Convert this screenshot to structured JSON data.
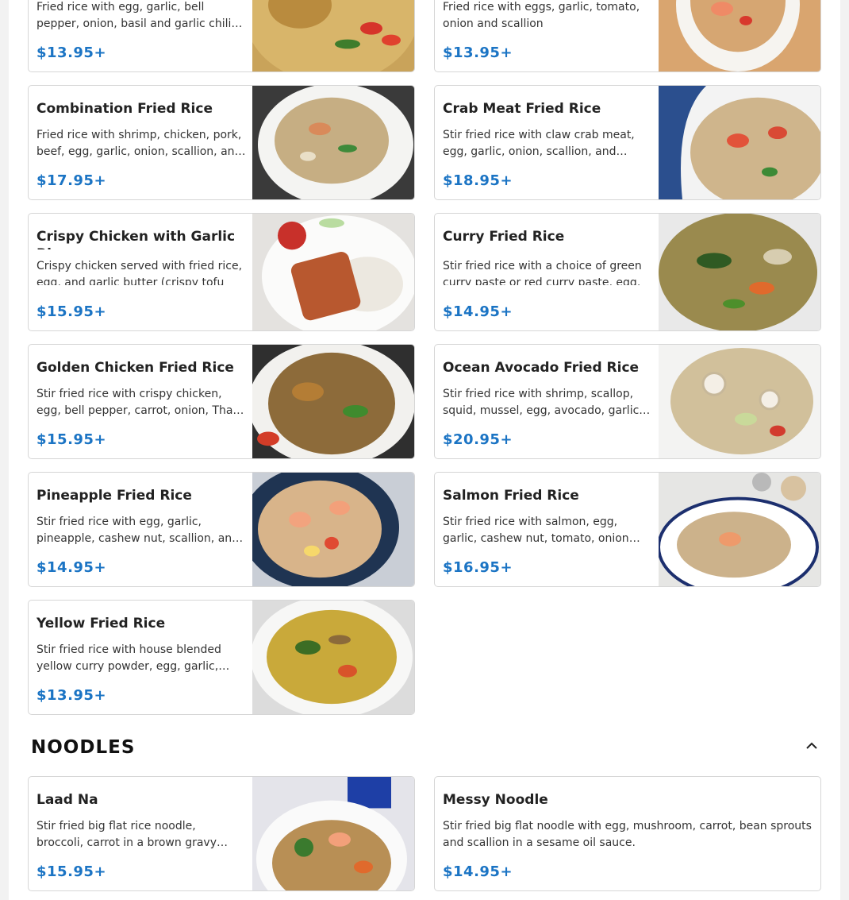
{
  "rice_items": [
    {
      "title": "",
      "desc": "Fried rice with egg, garlic, bell pepper, onion, basil and garlic chili sauce",
      "price": "$13.95+",
      "icon": "basil-fried-rice-photo"
    },
    {
      "title": "",
      "desc": "Fried rice with eggs, garlic, tomato, onion and scallion",
      "price": "$13.95+",
      "icon": "shrimp-fried-rice-photo"
    },
    {
      "title": "Combination Fried Rice",
      "desc": "Fried rice with shrimp, chicken, pork, beef, egg, garlic, onion, scallion, and tomato",
      "price": "$17.95+",
      "icon": "combination-fried-rice-photo"
    },
    {
      "title": "Crab Meat Fried Rice",
      "desc": "Stir fried rice with claw crab meat, egg, garlic, onion, scallion, and tomato",
      "price": "$18.95+",
      "icon": "crab-fried-rice-photo"
    },
    {
      "title": "Crispy Chicken with Garlic Rice",
      "desc": "Crispy chicken served with fried rice, egg, and garlic butter (crispy tofu available)",
      "price": "$15.95+",
      "icon": "crispy-chicken-photo"
    },
    {
      "title": "Curry Fried Rice",
      "desc": "Stir fried rice with a choice of green curry paste or red curry paste, egg, bamboo",
      "price": "$14.95+",
      "icon": "curry-fried-rice-photo"
    },
    {
      "title": "Golden Chicken Fried Rice",
      "desc": "Stir fried rice with crispy chicken, egg, bell pepper, carrot, onion, Thai chili",
      "price": "$15.95+",
      "icon": "golden-chicken-fried-rice-photo"
    },
    {
      "title": "Ocean Avocado Fried Rice",
      "desc": "Stir fried rice with shrimp, scallop, squid, mussel, egg, avocado, garlic and onion",
      "price": "$20.95+",
      "icon": "ocean-avocado-fried-rice-photo"
    },
    {
      "title": "Pineapple Fried Rice",
      "desc": "Stir fried rice with egg, garlic, pineapple, cashew nut, scallion, and raisin",
      "price": "$14.95+",
      "icon": "pineapple-fried-rice-photo"
    },
    {
      "title": "Salmon Fried Rice",
      "desc": "Stir fried rice with salmon, egg, garlic, cashew nut, tomato, onion and scallion",
      "price": "$16.95+",
      "icon": "salmon-fried-rice-photo"
    },
    {
      "title": "Yellow Fried Rice",
      "desc": "Stir fried rice with house blended yellow curry powder, egg, garlic, onion and tomato",
      "price": "$13.95+",
      "icon": "yellow-fried-rice-photo"
    }
  ],
  "noodles": {
    "section_title": "NOODLES",
    "collapse_icon": "chevron-up-icon",
    "items": [
      {
        "title": "Laad Na",
        "desc": "Stir fried big flat rice noodle, broccoli, carrot in a brown gravy sauce",
        "price": "$15.95+",
        "icon": "laad-na-photo"
      },
      {
        "title": "Messy Noodle",
        "desc": "Stir fried big flat noodle with egg, mushroom, carrot, bean sprouts and scallion in a sesame oil sauce.",
        "price": "$14.95+"
      }
    ]
  },
  "colors": {
    "price": "#1b74c4",
    "border": "#d6d6d6"
  }
}
